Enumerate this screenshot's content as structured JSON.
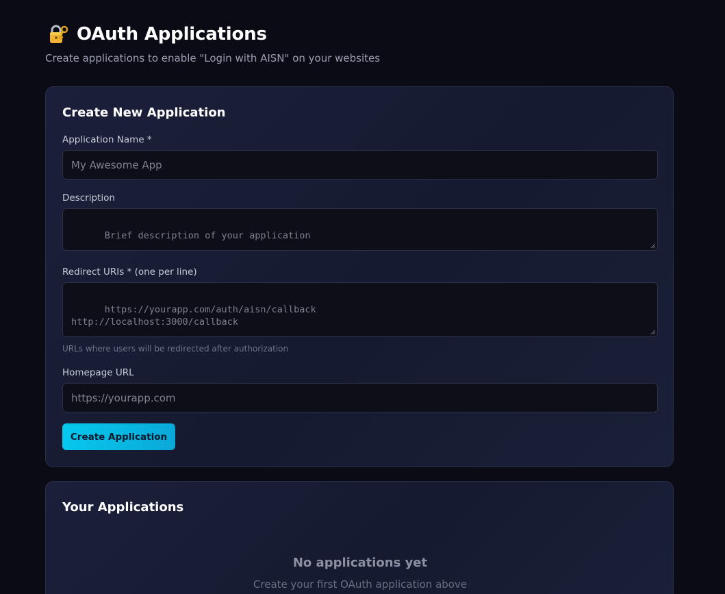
{
  "header": {
    "title": "OAuth Applications",
    "subtitle": "Create applications to enable \"Login with AISN\" on your websites",
    "icon": "lock-with-key-icon"
  },
  "create_form": {
    "title": "Create New Application",
    "app_name": {
      "label": "Application Name *",
      "placeholder": "My Awesome App",
      "value": ""
    },
    "description": {
      "label": "Description",
      "placeholder": "Brief description of your application",
      "value": ""
    },
    "redirect_uris": {
      "label": "Redirect URIs * (one per line)",
      "placeholder": "https://yourapp.com/auth/aisn/callback\nhttp://localhost:3000/callback",
      "value": "",
      "helper": "URLs where users will be redirected after authorization"
    },
    "homepage_url": {
      "label": "Homepage URL",
      "placeholder": "https://yourapp.com",
      "value": ""
    },
    "submit_label": "Create Application"
  },
  "applications": {
    "title": "Your Applications",
    "empty_title": "No applications yet",
    "empty_subtitle": "Create your first OAuth application above"
  },
  "colors": {
    "background": "#0b0b16",
    "card": "#1b1f3a",
    "accent": "#06c8ee"
  }
}
